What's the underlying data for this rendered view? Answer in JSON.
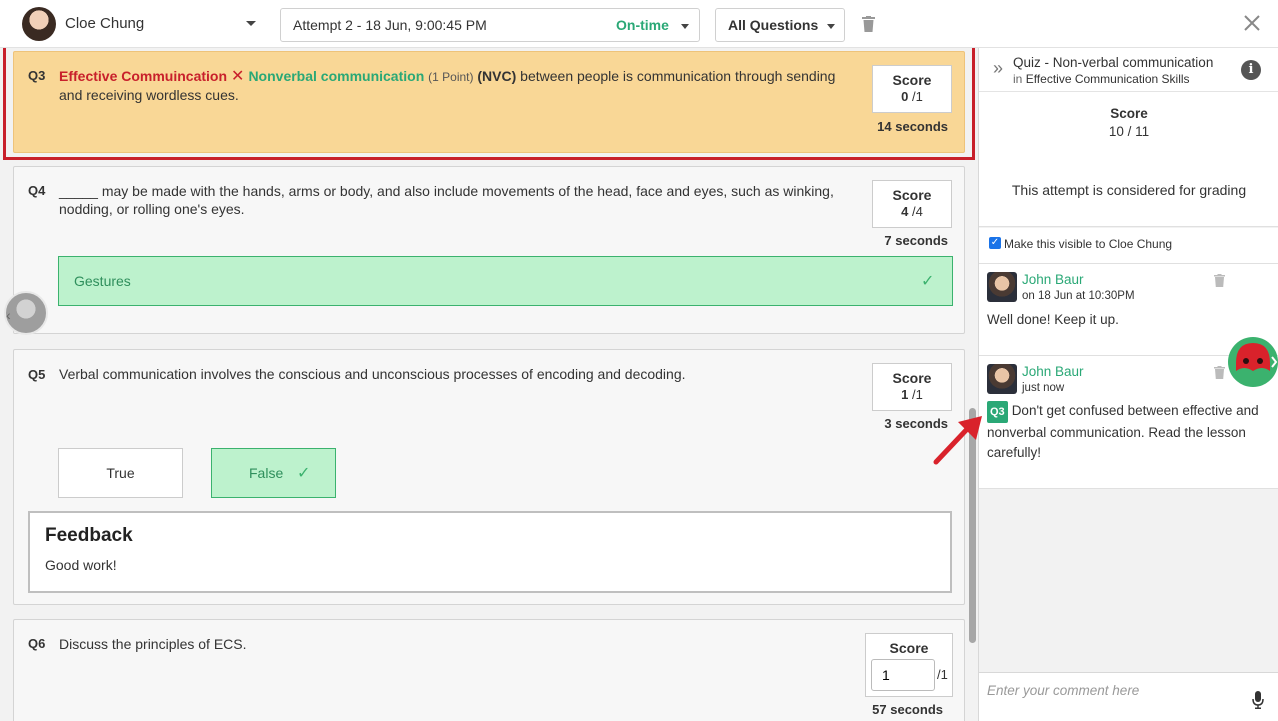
{
  "topbar": {
    "student": "Cloe Chung",
    "attempt": "Attempt 2 - 18 Jun, 9:00:45 PM",
    "attempt_status": "On-time",
    "filter": "All Questions"
  },
  "questions": {
    "q3": {
      "num": "Q3",
      "tag_wrong": "Effective Commuincation",
      "tag_right": "Nonverbal communication",
      "points": "(1 Point)",
      "abbr": "(NVC)",
      "text": " between people is communication through sending and receiving wordless cues.",
      "score_label": "Score",
      "score_got": "0",
      "score_total": "/1",
      "duration": "14 seconds"
    },
    "q4": {
      "num": "Q4",
      "text": "_____ may be made with the hands, arms or body, and also include movements of the head, face and eyes, such as winking, nodding, or rolling one's eyes.",
      "score_label": "Score",
      "score_got": "4",
      "score_total": "/4",
      "duration": "7 seconds",
      "answer": "Gestures"
    },
    "q5": {
      "num": "Q5",
      "text": "Verbal communication involves the conscious and unconscious processes of encoding and decoding.",
      "score_label": "Score",
      "score_got": "1",
      "score_total": "/1",
      "duration": "3 seconds",
      "option_true": "True",
      "option_false": "False",
      "feedback_title": "Feedback",
      "feedback_text": "Good work!"
    },
    "q6": {
      "num": "Q6",
      "text": "Discuss the principles of ECS.",
      "score_label": "Score",
      "score_value": "1",
      "score_total": "/1",
      "duration": "57 seconds"
    }
  },
  "panel": {
    "quiz_title": "Quiz - Non-verbal communication",
    "course_prefix": "in",
    "course": "Effective Communication Skills",
    "score_label": "Score",
    "score_value": "10 / 11",
    "grading_note": "This attempt is considered for grading",
    "visible_label": "Make this visible to Cloe Chung",
    "comments": [
      {
        "author": "John Baur",
        "time": "on 18 Jun at 10:30PM",
        "text": "Well done! Keep it up."
      },
      {
        "author": "John Baur",
        "time": "just now",
        "chip": "Q3",
        "text": "Don't get confused between effective and nonverbal communication. Read the lesson carefully!"
      }
    ],
    "comment_placeholder": "Enter your comment here"
  },
  "colors": {
    "accent_green": "#2aa876",
    "error_red": "#c8202b",
    "highlight_bg": "#f9d796"
  }
}
